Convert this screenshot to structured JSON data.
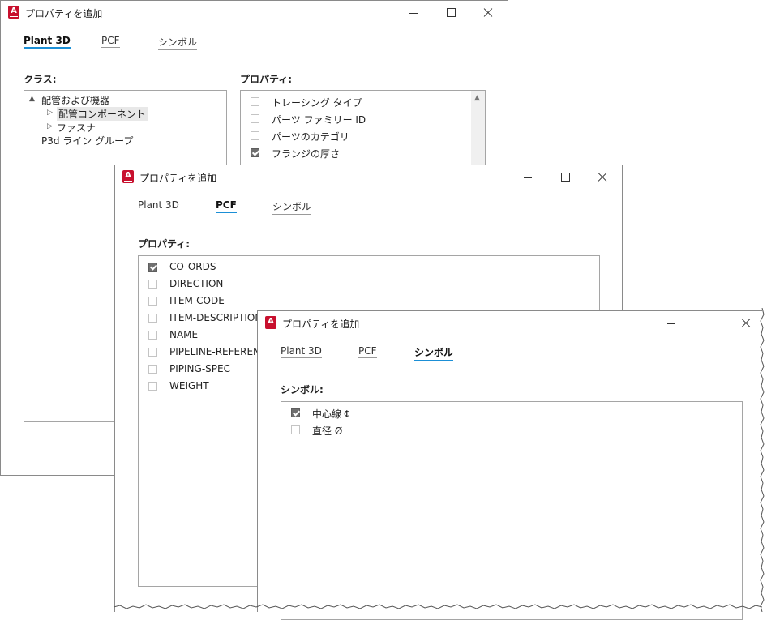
{
  "dialog1": {
    "title": "プロパティを追加",
    "app_icon_letter": "A",
    "tabs": [
      "Plant 3D",
      "PCF",
      "シンボル"
    ],
    "active_tab": "Plant 3D",
    "class_label": "クラス:",
    "tree": [
      {
        "label": "配管および機器",
        "expander": "▲"
      },
      {
        "label": "配管コンポーネント",
        "expander": "▷"
      },
      {
        "label": "ファスナ",
        "expander": "▷"
      },
      {
        "label": "P3d ライン グループ",
        "expander": ""
      }
    ],
    "properties_label": "プロパティ:",
    "properties": [
      {
        "label": "トレーシング タイプ",
        "checked": false
      },
      {
        "label": "パーツ ファミリー ID",
        "checked": false
      },
      {
        "label": "パーツのカテゴリ",
        "checked": false
      },
      {
        "label": "フランジの厚さ",
        "checked": true
      }
    ]
  },
  "dialog2": {
    "title": "プロパティを追加",
    "app_icon_letter": "A",
    "tabs": [
      "Plant 3D",
      "PCF",
      "シンボル"
    ],
    "active_tab": "PCF",
    "properties_label": "プロパティ:",
    "properties": [
      {
        "label": "CO-ORDS",
        "checked": true
      },
      {
        "label": "DIRECTION",
        "checked": false
      },
      {
        "label": "ITEM-CODE",
        "checked": false
      },
      {
        "label": "ITEM-DESCRIPTION",
        "checked": false
      },
      {
        "label": "NAME",
        "checked": false
      },
      {
        "label": "PIPELINE-REFERENCE",
        "checked": false
      },
      {
        "label": "PIPING-SPEC",
        "checked": false
      },
      {
        "label": "WEIGHT",
        "checked": false
      }
    ]
  },
  "dialog3": {
    "title": "プロパティを追加",
    "app_icon_letter": "A",
    "tabs": [
      "Plant 3D",
      "PCF",
      "シンボル"
    ],
    "active_tab": "シンボル",
    "symbols_label": "シンボル:",
    "symbols": [
      {
        "label": "中心線 ℄",
        "checked": true
      },
      {
        "label": "直径 Ø",
        "checked": false
      }
    ]
  },
  "colors": {
    "accent": "#1b8fd6",
    "app_icon": "#c8102e",
    "checked_box": "#6f6f6f"
  },
  "icons": [
    "app-icon",
    "minimize-icon",
    "maximize-icon",
    "close-icon",
    "expand-arrow-icon",
    "collapse-arrow-icon",
    "scroll-up-icon"
  ]
}
